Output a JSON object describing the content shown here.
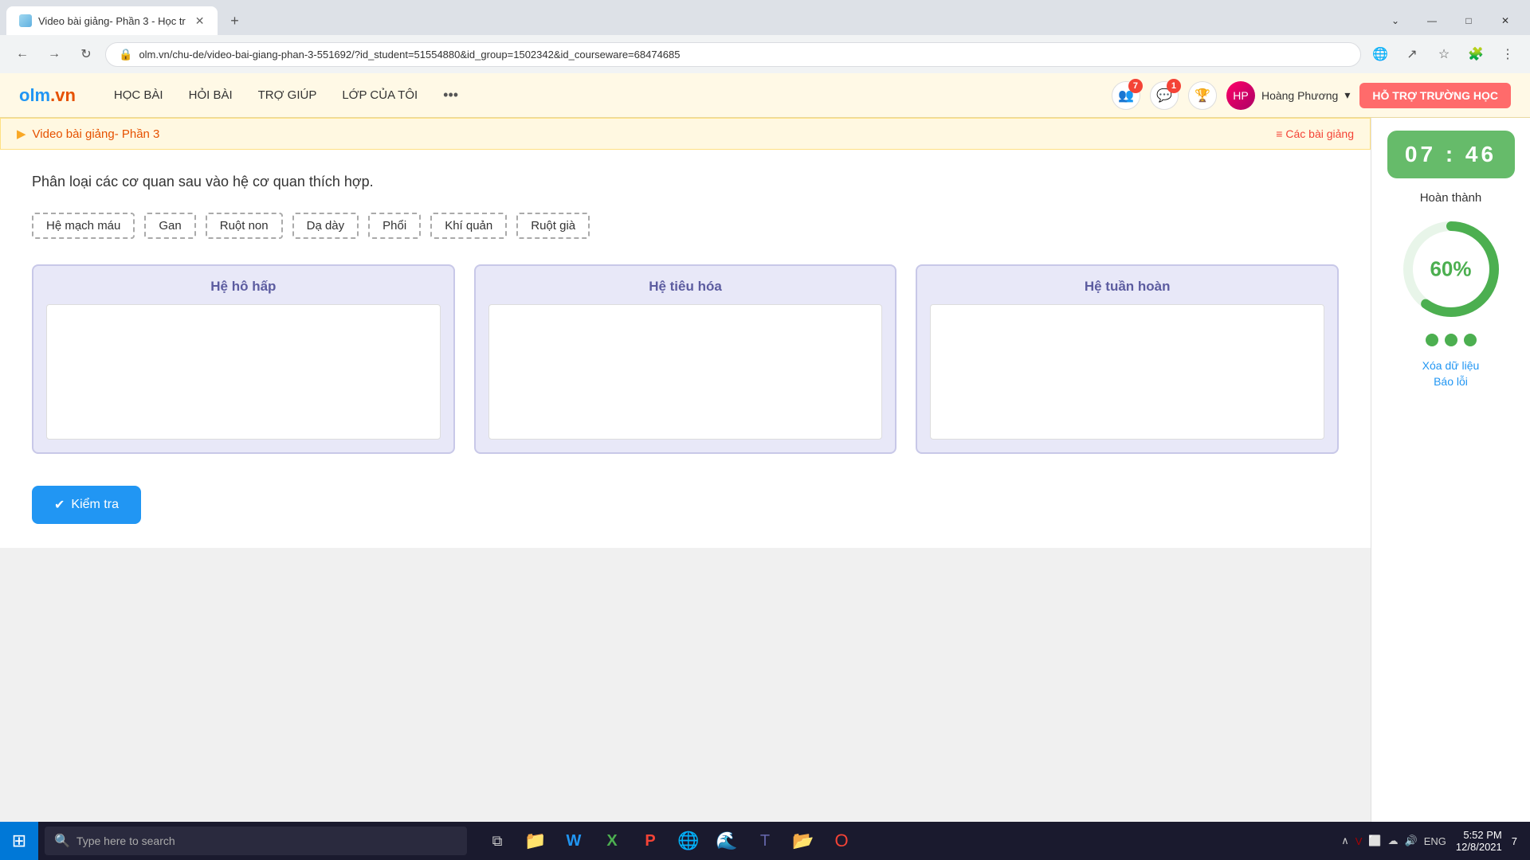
{
  "browser": {
    "tab_title": "Video bài giảng- Phần 3 - Học tr",
    "url": "olm.vn/chu-de/video-bai-giang-phan-3-551692/?id_student=51554880&id_group=1502342&id_courseware=68474685",
    "nav_back": "←",
    "nav_forward": "→",
    "nav_refresh": "↻",
    "new_tab": "+",
    "win_minimize": "—",
    "win_maximize": "□",
    "win_close": "✕",
    "chevron_down": "⌄"
  },
  "olm_nav": {
    "logo": "olm",
    "logo_suffix": ".vn",
    "link_hoc_bai": "HỌC BÀI",
    "link_hoi_bai": "HỎI BÀI",
    "link_tro_giup": "TRỢ GIÚP",
    "link_lop_cua_toi": "LỚP CỦA TÔI",
    "more": "•••",
    "badge_friends": "7",
    "badge_messages": "1",
    "user_name": "Hoàng Phương",
    "support_btn": "HỖ TRỢ TRƯỜNG HỌC"
  },
  "video_header": {
    "icon": "▶",
    "title": "Video bài giảng- Phần 3",
    "lessons_icon": "≡",
    "lessons_link": "Các bài giảng"
  },
  "exercise": {
    "question": "Phân loại các cơ quan sau vào hệ cơ quan thích hợp.",
    "drag_items": [
      "Hệ mạch máu",
      "Gan",
      "Ruột non",
      "Dạ dày",
      "Phổi",
      "Khí quản",
      "Ruột già"
    ],
    "drop_zones": [
      {
        "id": "ho-hap",
        "title": "Hệ hô hấp"
      },
      {
        "id": "tieu-hoa",
        "title": "Hệ tiêu hóa"
      },
      {
        "id": "tuan-hoan",
        "title": "Hệ tuần hoàn"
      }
    ],
    "check_btn_icon": "✔",
    "check_btn_label": "Kiểm tra"
  },
  "sidebar": {
    "timer": "07 : 46",
    "completion_label": "Hoàn thành",
    "progress_percent": "60%",
    "progress_value": 60,
    "dots": 3,
    "delete_link": "Xóa dữ liệu",
    "report_link": "Báo lỗi"
  },
  "taskbar": {
    "search_placeholder": "Type here to search",
    "time": "5:52 PM",
    "date": "12/8/2021",
    "lang": "ENG",
    "notif_count": "7"
  }
}
